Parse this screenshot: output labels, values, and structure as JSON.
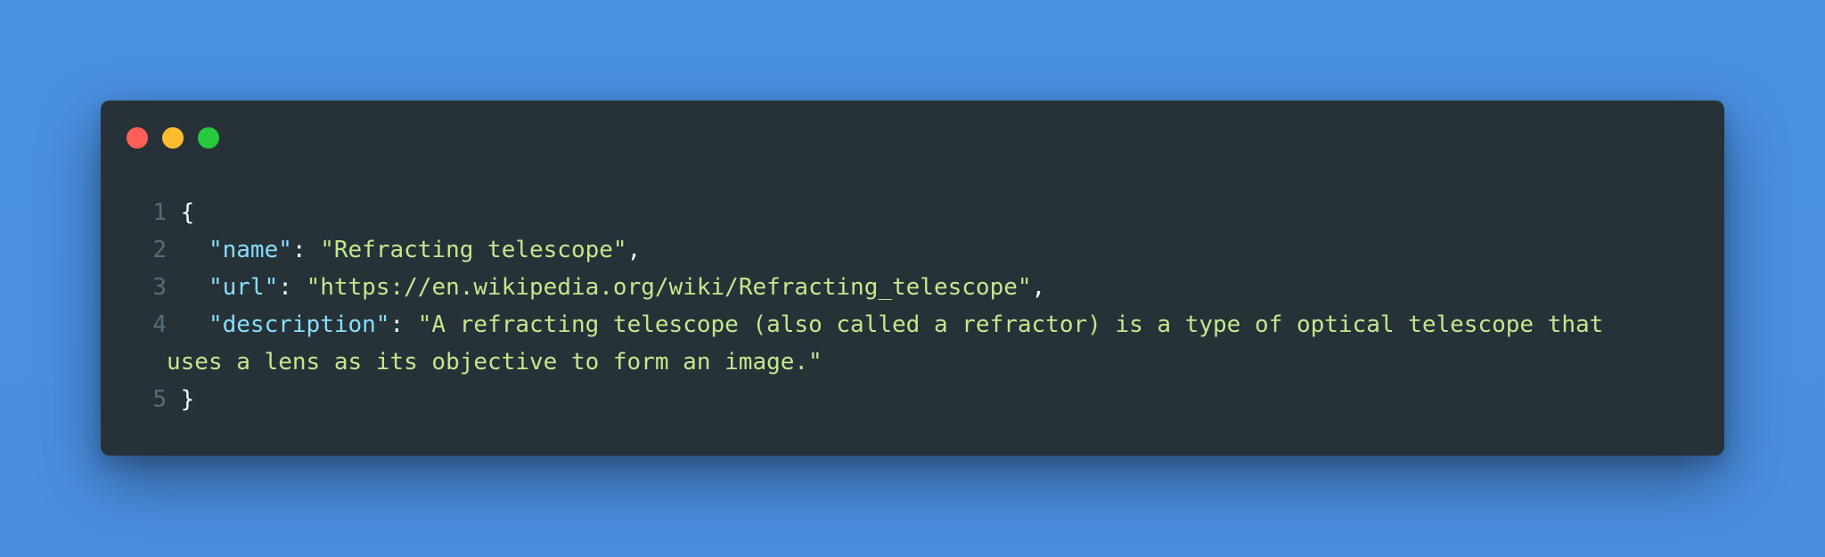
{
  "window": {
    "controls": [
      {
        "name": "close",
        "color": "#ff5f56"
      },
      {
        "name": "minimize",
        "color": "#ffbd2e"
      },
      {
        "name": "maximize",
        "color": "#27c93f"
      }
    ]
  },
  "code": {
    "lines": [
      {
        "number": "1",
        "open": "{"
      },
      {
        "number": "2",
        "key": "\"name\"",
        "sep": ": ",
        "value": "\"Refracting telescope\"",
        "end": ","
      },
      {
        "number": "3",
        "key": "\"url\"",
        "sep": ": ",
        "value": "\"https://en.wikipedia.org/wiki/Refracting_telescope\"",
        "end": ","
      },
      {
        "number": "4",
        "key": "\"description\"",
        "sep": ": ",
        "value": "\"A refracting telescope (also called a refractor) is a type of optical telescope that uses a lens as its objective to form an image.\"",
        "end": ""
      },
      {
        "number": "5",
        "close": "}"
      }
    ],
    "colors": {
      "background": "#263238",
      "line_number": "#546e7a",
      "key": "#89ddff",
      "string": "#c3e88d",
      "punctuation": "#eeffff"
    }
  }
}
